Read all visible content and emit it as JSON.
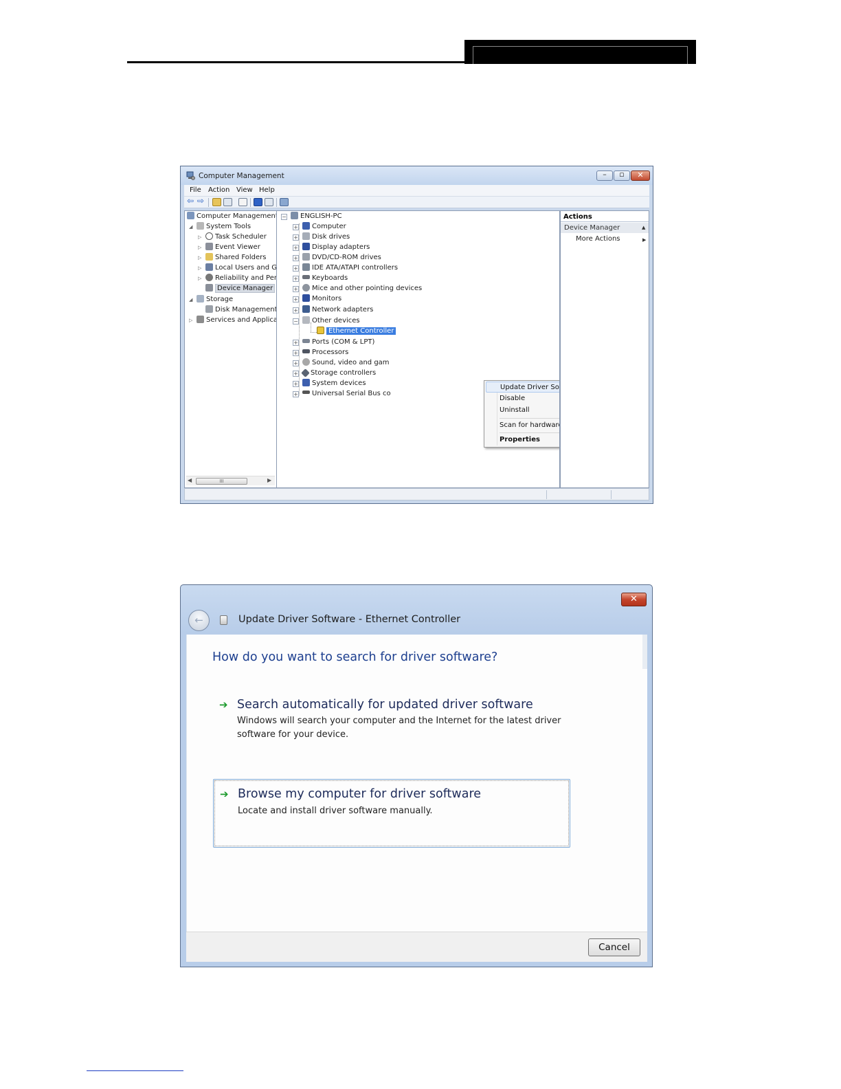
{
  "computer_management": {
    "title": "Computer Management",
    "menu": [
      "File",
      "Action",
      "View",
      "Help"
    ],
    "left_tree": [
      "Computer Management",
      "System Tools",
      "Task Scheduler",
      "Event Viewer",
      "Shared Folders",
      "Local Users and Gr",
      "Reliability and Perf",
      "Device Manager",
      "Storage",
      "Disk Management",
      "Services and Applicat"
    ],
    "scrollbar_grip": "III",
    "device_tree": {
      "root": "ENGLISH-PC",
      "categories": [
        "Computer",
        "Disk drives",
        "Display adapters",
        "DVD/CD-ROM drives",
        "IDE ATA/ATAPI controllers",
        "Keyboards",
        "Mice and other pointing devices",
        "Monitors",
        "Network adapters",
        "Other devices",
        "Ethernet Controller",
        "Ports (COM & LPT)",
        "Processors",
        "Sound, video and gam",
        "Storage controllers",
        "System devices",
        "Universal Serial Bus co"
      ]
    },
    "actions_pane": {
      "header": "Actions",
      "group": "Device Manager",
      "item": "More Actions"
    },
    "context_menu": [
      "Update Driver Software...",
      "Disable",
      "Uninstall",
      "Scan for hardware changes",
      "Properties"
    ]
  },
  "update_driver": {
    "title": "Update Driver Software - Ethernet Controller",
    "question": "How do you want to search for driver software?",
    "options": [
      {
        "title": "Search automatically for updated driver software",
        "description": "Windows will search your computer and the Internet for the latest driver software for your device."
      },
      {
        "title": "Browse my computer for driver software",
        "description": "Locate and install driver software manually."
      }
    ],
    "cancel_label": "Cancel"
  },
  "icons": {
    "back": "back-arrow-icon",
    "option_arrow": "green-arrow-icon",
    "close": "close-icon"
  }
}
